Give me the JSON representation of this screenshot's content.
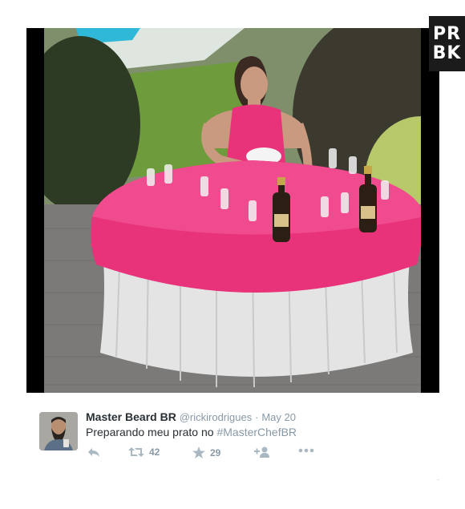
{
  "watermark": {
    "line1": "PR",
    "line2": "BK"
  },
  "tweet": {
    "name": "Master Beard BR",
    "handle": "@rickirodrigues",
    "separator": "·",
    "date": "May 20",
    "text": "Preparando meu prato no",
    "hashtag": "#MasterChefBR",
    "retweets": "42",
    "favorites": "29"
  },
  "icons": [
    "reply-icon",
    "retweet-icon",
    "favorite-icon",
    "follow-icon",
    "more-icon"
  ],
  "colors": {
    "table_pink": "#e8337a",
    "table_white": "#e6e6e6",
    "link": "#8899a6"
  }
}
